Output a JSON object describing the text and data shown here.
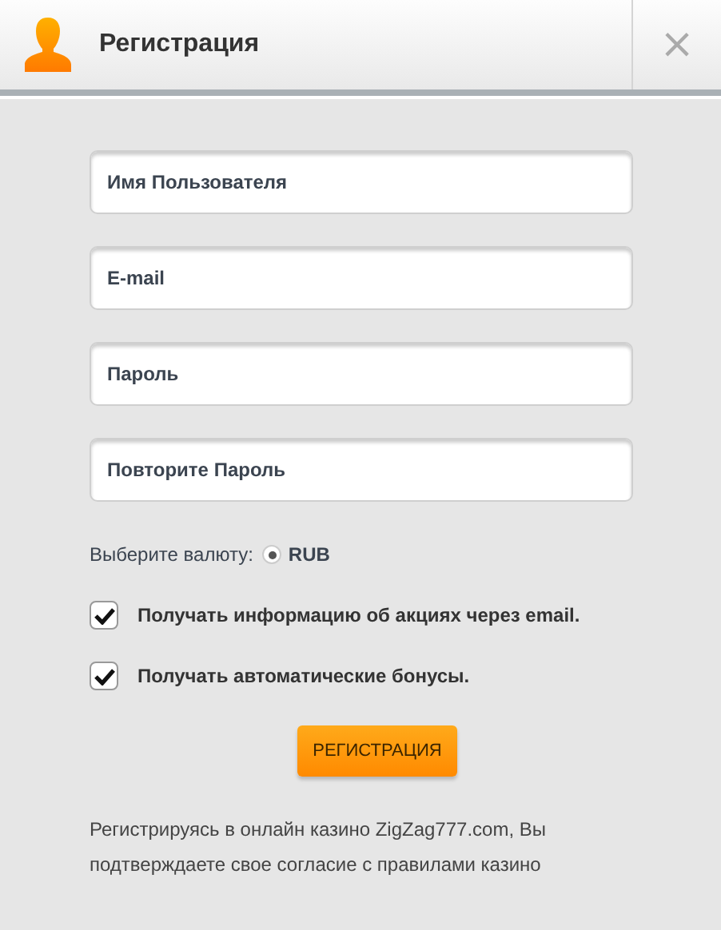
{
  "dialog": {
    "title": "Регистрация",
    "close": "×"
  },
  "fields": [
    {
      "placeholder": "Имя Пользователя"
    },
    {
      "placeholder": "E-mail"
    },
    {
      "placeholder": "Пароль"
    },
    {
      "placeholder": "Повторите Пароль"
    }
  ],
  "currency": {
    "label": "Выберите валюту:",
    "options": [
      {
        "label": "RUB",
        "selected": true
      }
    ]
  },
  "checkboxes": [
    {
      "label": "Получать информацию об акциях через email.",
      "checked": true
    },
    {
      "label": "Получать автоматические бонусы.",
      "checked": true
    }
  ],
  "submit": "РЕГИСТРАЦИЯ",
  "note": "Регистрируясь в онлайн казино ZigZag777.com, Вы подтверждаете свое согласие с правилами казино"
}
